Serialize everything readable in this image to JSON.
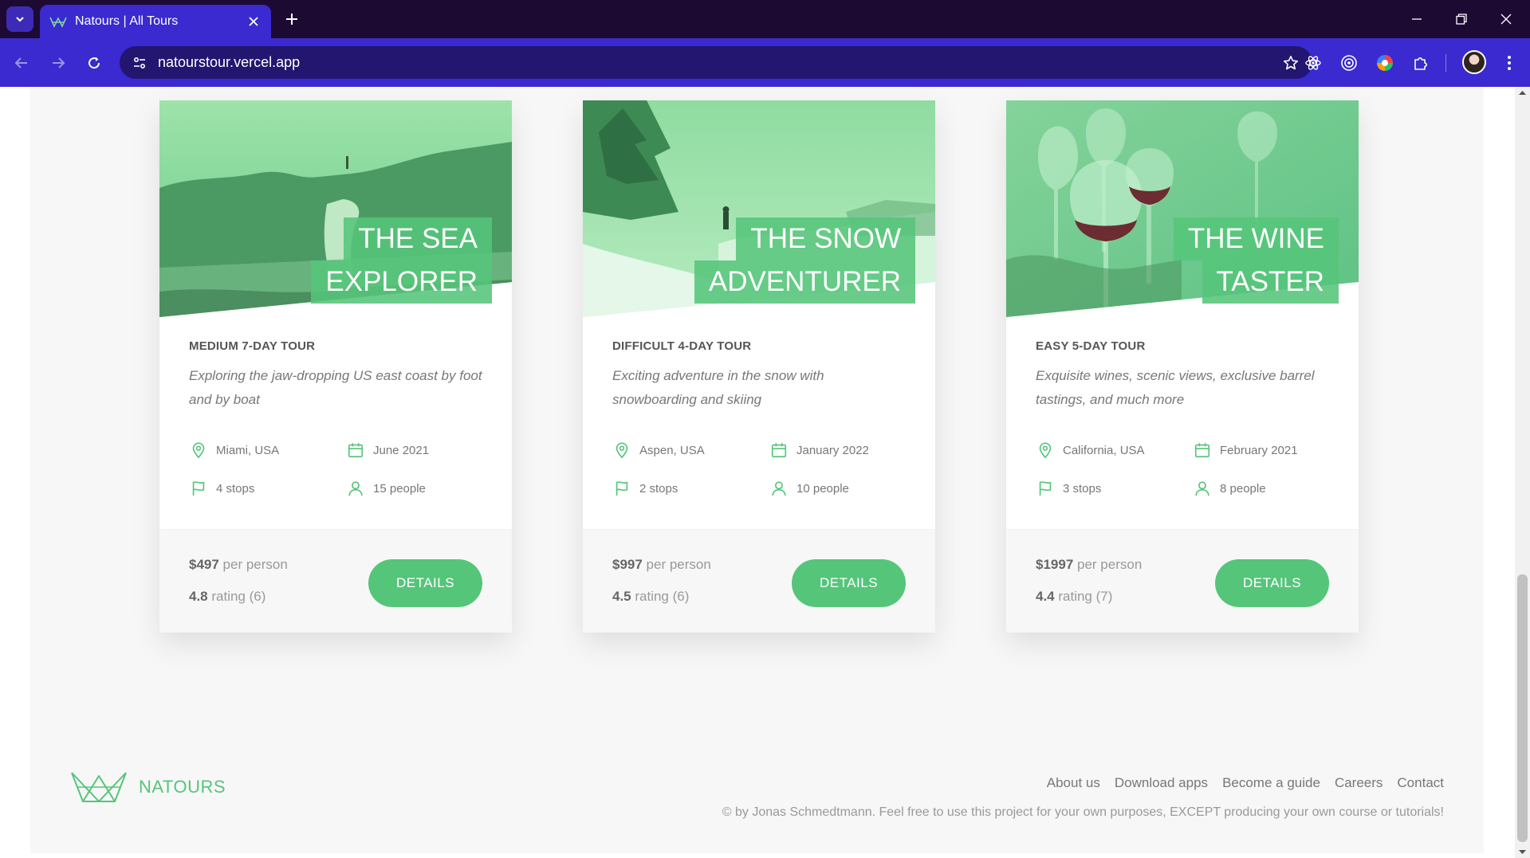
{
  "browser": {
    "tab_title": "Natours | All Tours",
    "url": "natourstour.vercel.app"
  },
  "cards": [
    {
      "title_line1": "THE SEA",
      "title_line2": "EXPLORER",
      "difficulty": "MEDIUM 7-DAY TOUR",
      "summary": "Exploring the jaw-dropping US east coast by foot and by boat",
      "location": "Miami, USA",
      "date": "June 2021",
      "stops": "4 stops",
      "people": "15 people",
      "price": "$497",
      "price_suffix": " per person",
      "rating": "4.8",
      "rating_suffix": " rating (6)",
      "button": "DETAILS"
    },
    {
      "title_line1": "THE SNOW",
      "title_line2": "ADVENTURER",
      "difficulty": "DIFFICULT 4-DAY TOUR",
      "summary": "Exciting adventure in the snow with snowboarding and skiing",
      "location": "Aspen, USA",
      "date": "January 2022",
      "stops": "2 stops",
      "people": "10 people",
      "price": "$997",
      "price_suffix": " per person",
      "rating": "4.5",
      "rating_suffix": " rating (6)",
      "button": "DETAILS"
    },
    {
      "title_line1": "THE WINE",
      "title_line2": "TASTER",
      "difficulty": "EASY 5-DAY TOUR",
      "summary": "Exquisite wines, scenic views, exclusive barrel tastings, and much more",
      "location": "California, USA",
      "date": "February 2021",
      "stops": "3 stops",
      "people": "8 people",
      "price": "$1997",
      "price_suffix": " per person",
      "rating": "4.4",
      "rating_suffix": " rating (7)",
      "button": "DETAILS"
    }
  ],
  "footer": {
    "logo_text": "NATOURS",
    "links": [
      "About us",
      "Download apps",
      "Become a guide",
      "Careers",
      "Contact"
    ],
    "copyright": "© by Jonas Schmedtmann. Feel free to use this project for your own purposes, EXCEPT producing your own course or tutorials!"
  },
  "colors": {
    "brand_green": "#55c57a",
    "chrome_bg": "#1c0a33",
    "chrome_toolbar": "#3a2ad0"
  }
}
